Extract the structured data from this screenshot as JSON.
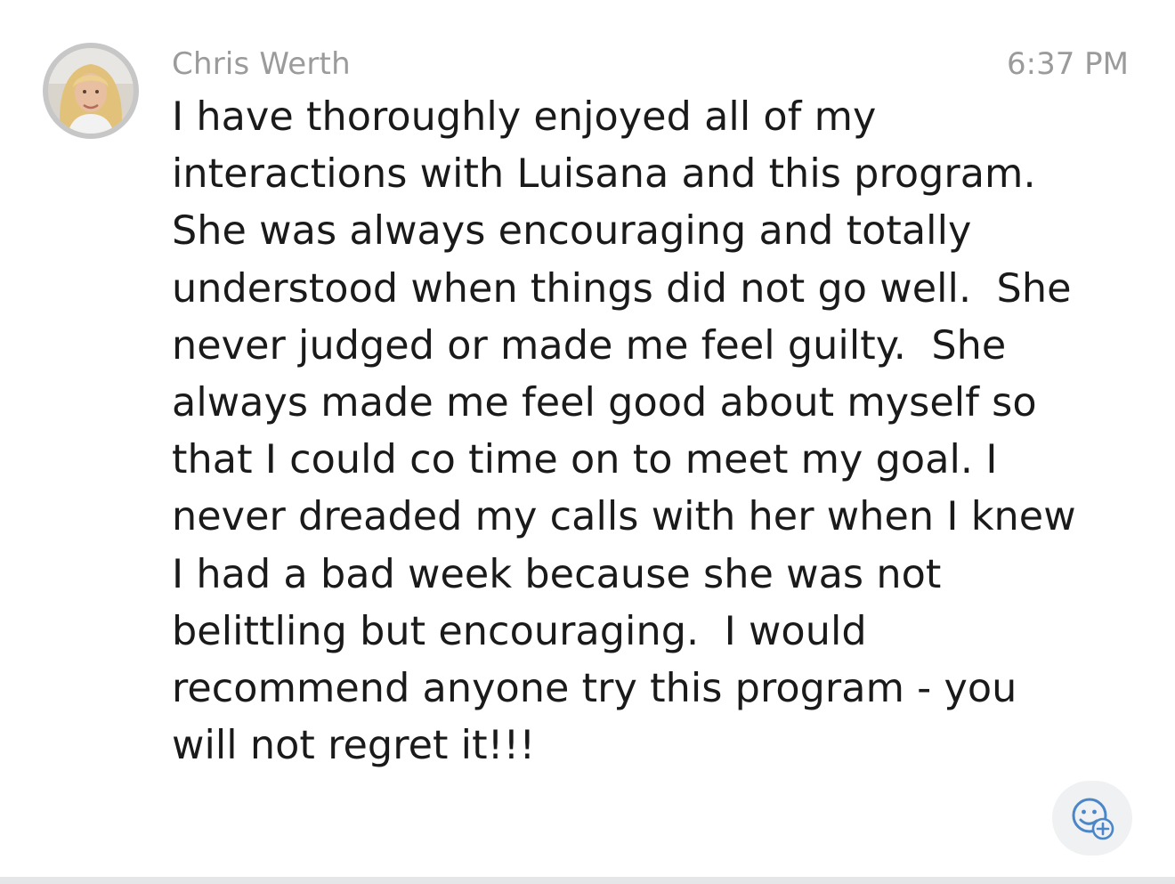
{
  "message": {
    "sender": "Chris Werth",
    "time": "6:37 PM",
    "text": "I have thoroughly enjoyed all of my\ninteractions with Luisana and this program.\nShe was always encouraging and totally\nunderstood when things did not go well.  She\nnever judged or made me feel guilty.  She\nalways made me feel good about myself so\nthat I could co time on to meet my goal. I\nnever dreaded my calls with her when I knew\nI had a bad week because she was not\nbelittling but encouraging.  I would\nrecommend anyone try this program - you\nwill not regret it!!!"
  },
  "icons": {
    "avatar": "user-avatar-photo",
    "reaction": "add-reaction-emoji-icon"
  },
  "colors": {
    "meta_text": "#9b9b9b",
    "body_text": "#1a1a1a",
    "reaction_icon": "#4a86c8",
    "reaction_bg": "#f0f1f2"
  }
}
